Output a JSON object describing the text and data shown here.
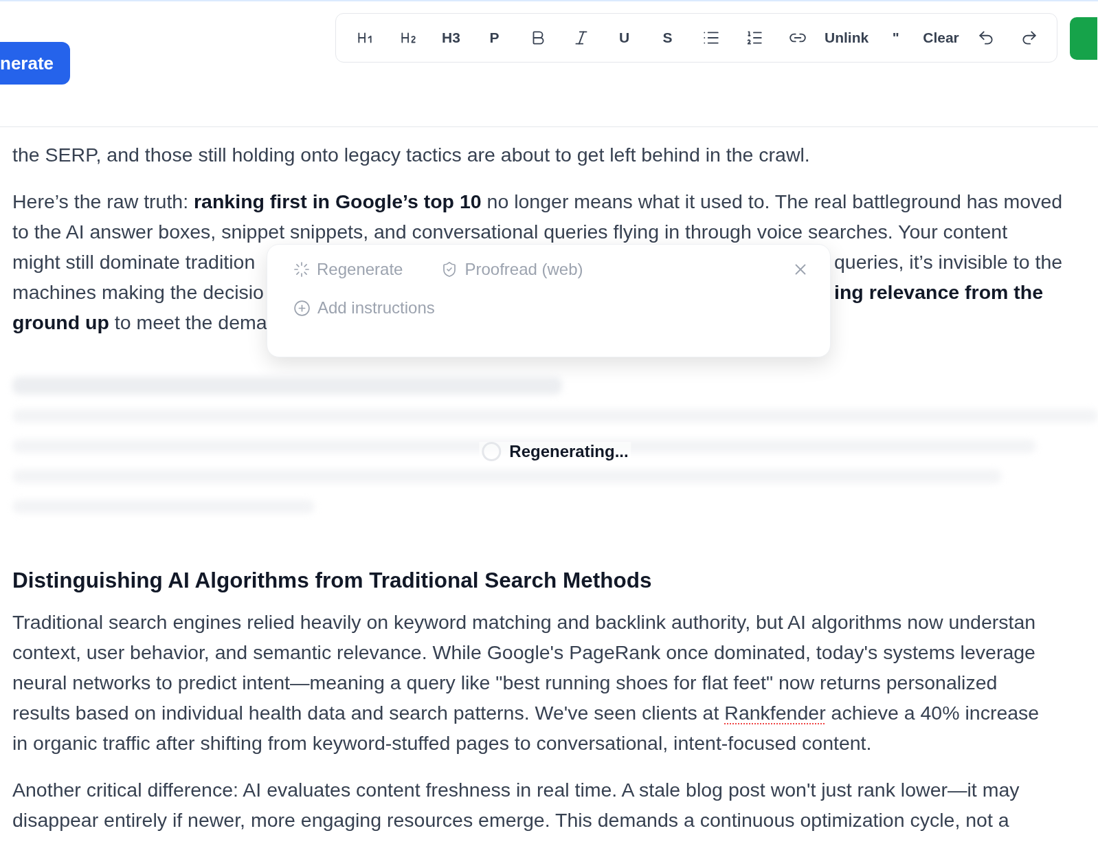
{
  "header": {
    "generate_button": "nerate",
    "toolbar": [
      {
        "kind": "icon"
      },
      {
        "kind": "icon"
      },
      {
        "kind": "text",
        "label": "H3"
      },
      {
        "kind": "text",
        "label": "P"
      },
      {
        "kind": "icon"
      },
      {
        "kind": "icon"
      },
      {
        "kind": "text",
        "label": "U"
      },
      {
        "kind": "text",
        "label": "S"
      },
      {
        "kind": "icon"
      },
      {
        "kind": "icon"
      },
      {
        "kind": "icon"
      },
      {
        "kind": "text",
        "label": "Unlink"
      },
      {
        "kind": "text",
        "label": "\""
      },
      {
        "kind": "text",
        "label": "Clear"
      },
      {
        "kind": "icon"
      },
      {
        "kind": "icon"
      }
    ]
  },
  "paragraphs": [
    {
      "lines": [
        {
          "kind": "full",
          "text": "the SERP, and those still holding onto legacy tactics are about to get left behind in the crawl."
        }
      ]
    },
    {
      "popup": {
        "actions": [
          {
            "label": "Regenerate",
            "disabled": true
          },
          {
            "label": "Proofread (web)",
            "disabled": true
          }
        ],
        "add_instructions": {
          "label": "Add instructions",
          "disabled": true
        }
      },
      "lines": [
        {
          "kind": "full",
          "text": "Here’s the raw truth: **ranking first in Google’s top 10** no longer means what it used to. The real battleground has moved"
        },
        {
          "kind": "full",
          "text": "to the AI answer boxes, snippet snippets, and conversational queries flying in through voice searches. Your content"
        },
        {
          "kind": "split",
          "left": "might still dominate tradition",
          "right": "queries, it’s invisible to the"
        },
        {
          "kind": "split",
          "left": "machines making the decisio",
          "right": "**ing relevance from the**"
        },
        {
          "kind": "split",
          "left": "**ground up** to meet the dema"
        }
      ]
    }
  ],
  "regenerating_section": {
    "regenerating": true,
    "status": "Regenerating..."
  },
  "section": {
    "heading": "Distinguishing AI Algorithms from Traditional Search Methods",
    "paragraphs": [
      {
        "lines": [
          {
            "kind": "full",
            "text": "Traditional search engines relied heavily on keyword matching and backlink authority, but AI algorithms now understan"
          },
          {
            "kind": "full",
            "text": "context, user behavior, and semantic relevance. While Google's PageRank once dominated, today's systems leverage"
          },
          {
            "kind": "full",
            "text": "neural networks to predict intent—meaning a query like \"best running shoes for flat feet\" now returns personalized"
          },
          {
            "kind": "marked",
            "before": "results based on individual health data and search patterns. We've seen clients at ",
            "flagged": "Rankfender",
            "after": " achieve a 40% increase"
          },
          {
            "kind": "full",
            "text": "in organic traffic after shifting from keyword-stuffed pages to conversational, intent-focused content."
          }
        ]
      },
      {
        "lines": [
          {
            "kind": "full",
            "text": "Another critical difference: AI evaluates content freshness in real time. A stale blog post won't just rank lower—it may"
          },
          {
            "kind": "full",
            "text": "disappear entirely if newer, more engaging resources emerge. This demands a continuous optimization cycle, not a"
          }
        ]
      }
    ]
  }
}
